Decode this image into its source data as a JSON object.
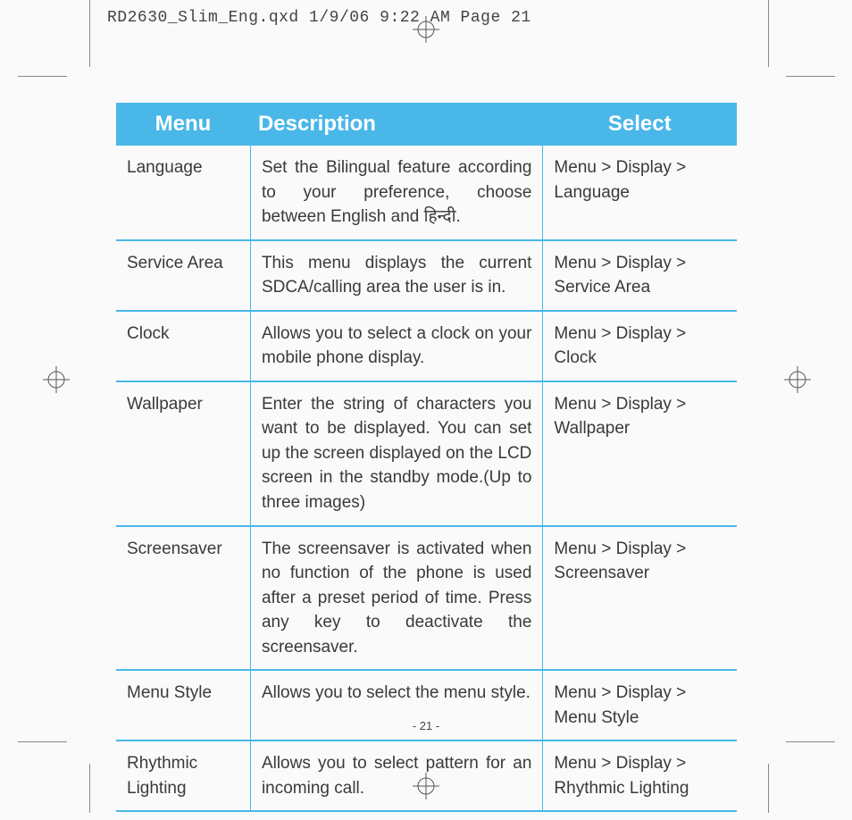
{
  "header": "RD2630_Slim_Eng.qxd  1/9/06  9:22 AM  Page 21",
  "columns": {
    "menu": "Menu",
    "desc": "Description",
    "select": "Select"
  },
  "rows": [
    {
      "menu": "Language",
      "desc": "Set the Bilingual feature according to your preference, choose between English and हिन्दी.",
      "select": "Menu > Display > Language"
    },
    {
      "menu": "Service Area",
      "desc": "This menu displays the current SDCA/calling area the user is in.",
      "select": "Menu > Display > Service Area"
    },
    {
      "menu": "Clock",
      "desc": "Allows you to select a clock on your mobile phone display.",
      "select": "Menu > Display > Clock"
    },
    {
      "menu": "Wallpaper",
      "desc": "Enter the string of characters you want to be displayed. You can set up the screen displayed on the LCD screen in the standby mode.(Up to three images)",
      "select": "Menu > Display > Wallpaper"
    },
    {
      "menu": "Screensaver",
      "desc": "The screensaver is activated when no function of the phone is used after a preset period of time. Press any key to deactivate the screensaver.",
      "select": "Menu > Display > Screensaver"
    },
    {
      "menu": "Menu Style",
      "desc": "Allows you to select the menu style.",
      "select": "Menu > Display > Menu Style"
    },
    {
      "menu": "Rhythmic Lighting",
      "desc": "Allows you to select pattern for an incoming call.",
      "select": "Menu > Display > Rhythmic Lighting"
    }
  ],
  "page_num": "- 21 -"
}
